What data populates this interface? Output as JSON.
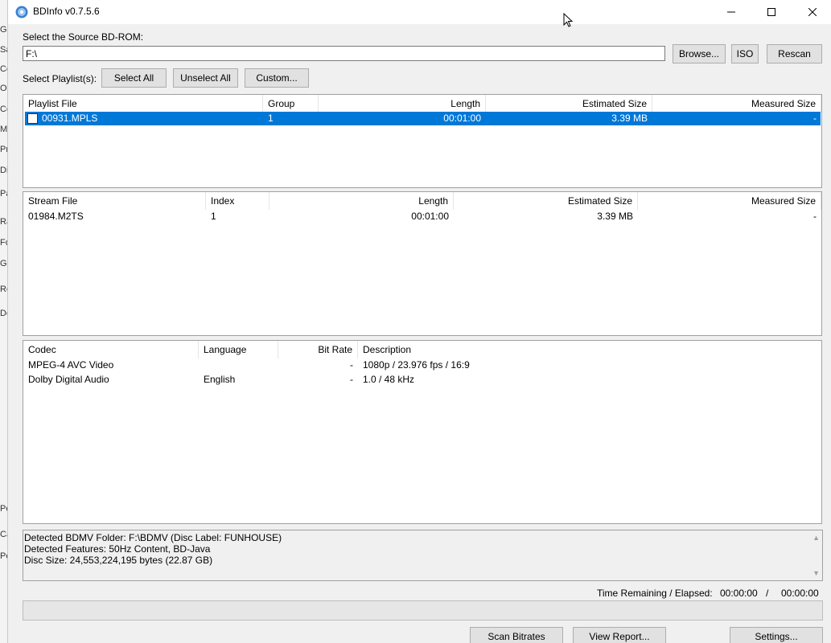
{
  "window": {
    "title": "BDInfo v0.7.5.6"
  },
  "background_fragments": [
    "Ge",
    "Sa",
    "Co",
    "Or",
    "Co",
    "Me",
    "Pr",
    "Di",
    "Pa",
    "Ra",
    "Fo",
    "Ge",
    "Re",
    "De",
    "Pe",
    "Ca",
    "Pe"
  ],
  "source": {
    "label": "Select the Source BD-ROM:",
    "value": "F:\\",
    "browse": "Browse...",
    "iso": "ISO",
    "rescan": "Rescan"
  },
  "playlists": {
    "label": "Select Playlist(s):",
    "select_all": "Select All",
    "unselect_all": "Unselect All",
    "custom": "Custom..."
  },
  "playlist_table": {
    "headers": [
      "Playlist File",
      "Group",
      "Length",
      "Estimated Size",
      "Measured Size"
    ],
    "rows": [
      {
        "file": "00931.MPLS",
        "group": "1",
        "length": "00:01:00",
        "estimated": "3.39 MB",
        "measured": "-",
        "checked": false,
        "selected": true
      }
    ]
  },
  "stream_table": {
    "headers": [
      "Stream File",
      "Index",
      "Length",
      "Estimated Size",
      "Measured Size"
    ],
    "rows": [
      {
        "file": "01984.M2TS",
        "index": "1",
        "length": "00:01:00",
        "estimated": "3.39 MB",
        "measured": "-"
      }
    ]
  },
  "codec_table": {
    "headers": [
      "Codec",
      "Language",
      "Bit Rate",
      "Description"
    ],
    "rows": [
      {
        "codec": "MPEG-4 AVC Video",
        "language": "",
        "bitrate": "-",
        "description": "1080p / 23.976 fps / 16:9"
      },
      {
        "codec": "Dolby Digital Audio",
        "language": "English",
        "bitrate": "-",
        "description": "1.0 / 48 kHz"
      }
    ]
  },
  "log": [
    "Detected BDMV Folder: F:\\BDMV (Disc Label: FUNHOUSE)",
    "Detected Features: 50Hz Content, BD-Java",
    "Disc Size: 24,553,224,195 bytes (22.87 GB)"
  ],
  "time": {
    "label": "Time Remaining / Elapsed:",
    "remaining": "00:00:00",
    "separator": "/",
    "elapsed": "00:00:00"
  },
  "progress": {
    "fraction": 0
  },
  "bottom_buttons": {
    "scan": "Scan Bitrates",
    "report": "View Report...",
    "settings": "Settings..."
  },
  "colors": {
    "selection": "#0078d7",
    "selection_text": "#ffffff",
    "window_bg": "#f0f0f0"
  }
}
